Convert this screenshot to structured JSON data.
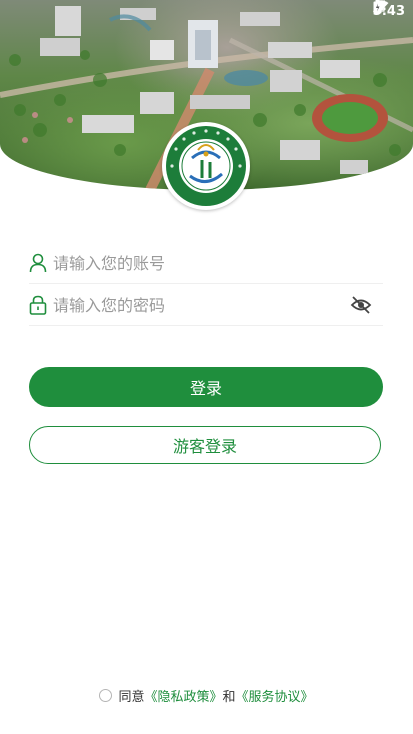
{
  "status_bar": {
    "time": "5:43"
  },
  "logo": {
    "name": "Guizhou Agricultural Vocational College",
    "ring_text": "贵州农业职业学院"
  },
  "login_form": {
    "account_placeholder": "请输入您的账号",
    "password_placeholder": "请输入您的密码"
  },
  "buttons": {
    "login": "登录",
    "guest_login": "游客登录"
  },
  "agreement": {
    "prefix": "同意",
    "privacy": "《隐私政策》",
    "and": "和",
    "service": "《服务协议》"
  },
  "colors": {
    "primary": "#1f8e3d",
    "text_muted": "#9a9a9a"
  }
}
